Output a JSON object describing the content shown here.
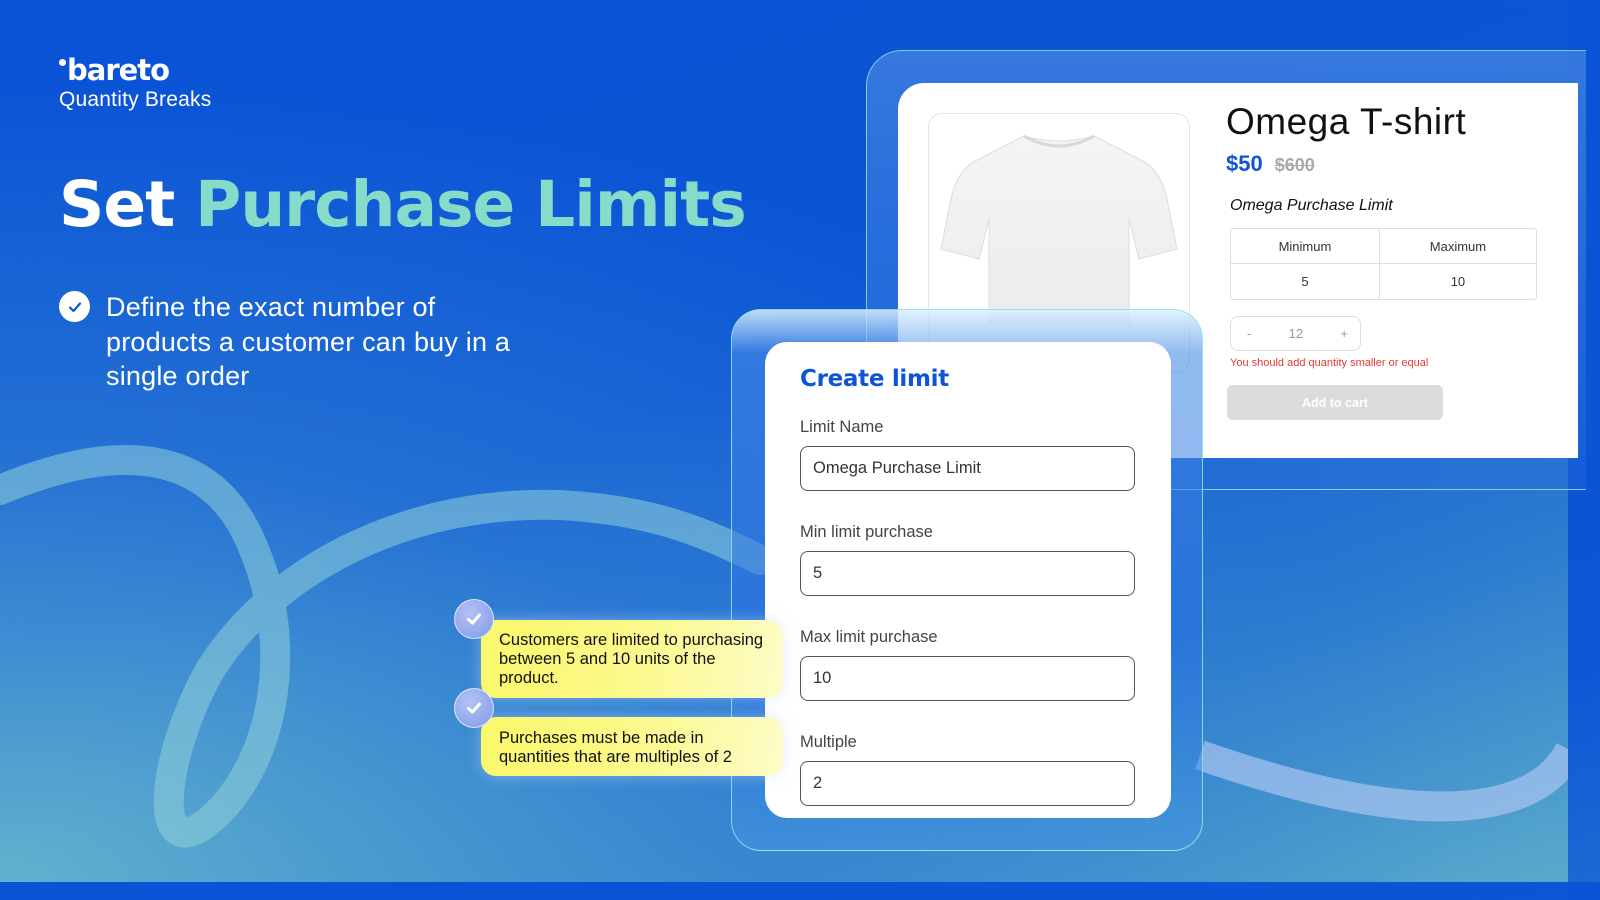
{
  "brand": {
    "logo_text": "bareto",
    "product_name": "Quantity Breaks",
    "accent_color": "#86dbc9",
    "primary_color": "#0d55d6"
  },
  "headline": {
    "part1": "Set ",
    "part2": "Purchase Limits"
  },
  "feature": {
    "icon": "check-circle-icon",
    "text": "Define the exact number of products a customer can buy in a single order"
  },
  "product": {
    "image_alt": "white t-shirt",
    "title": "Omega T-shirt",
    "price": "$50",
    "old_price": "$600",
    "limit_title": "Omega Purchase Limit",
    "table": {
      "headers": [
        "Minimum",
        "Maximum"
      ],
      "row": [
        "5",
        "10"
      ]
    },
    "quantity": {
      "minus": "-",
      "value": "12",
      "plus": "+"
    },
    "error": "You should add quantity smaller or equal",
    "add_to_cart": "Add to cart"
  },
  "form": {
    "title": "Create limit",
    "fields": [
      {
        "label": "Limit Name",
        "value": "Omega Purchase Limit"
      },
      {
        "label": "Min limit purchase",
        "value": "5"
      },
      {
        "label": "Max limit purchase",
        "value": "10"
      },
      {
        "label": "Multiple",
        "value": "2"
      }
    ]
  },
  "notes": [
    {
      "icon": "check-icon",
      "text": "Customers are limited to purchasing between 5 and 10 units of the product."
    },
    {
      "icon": "check-icon",
      "text": "Purchases must be made in quantities that are multiples of 2"
    }
  ]
}
